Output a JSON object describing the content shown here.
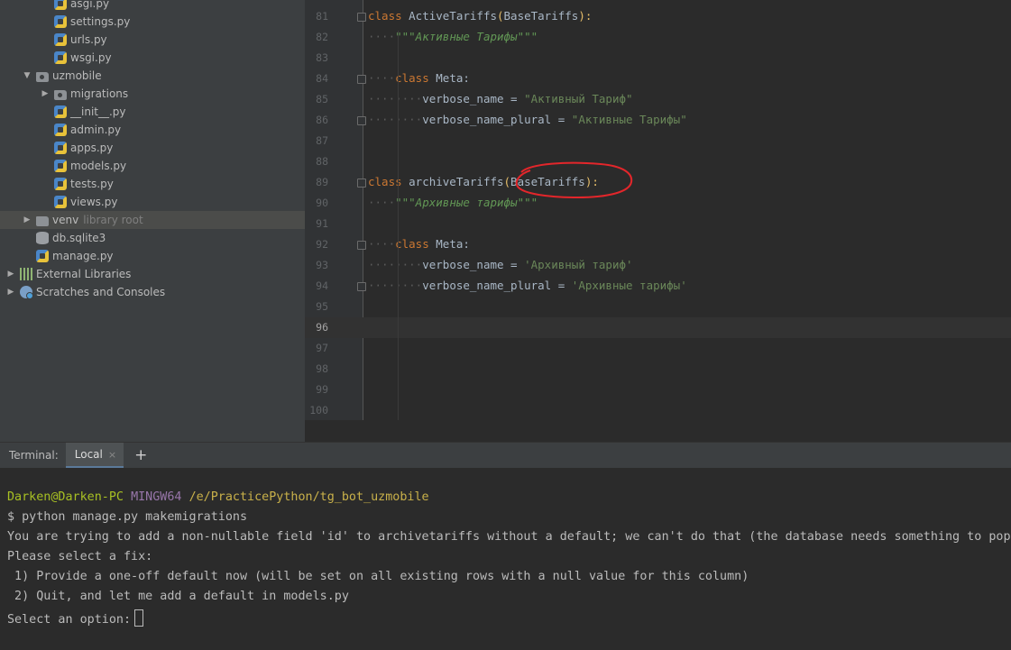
{
  "project_tree": {
    "items": [
      {
        "label": "asgi.py",
        "type": "py",
        "depth": 3,
        "arrow": ""
      },
      {
        "label": "settings.py",
        "type": "py",
        "depth": 3,
        "arrow": ""
      },
      {
        "label": "urls.py",
        "type": "py",
        "depth": 3,
        "arrow": ""
      },
      {
        "label": "wsgi.py",
        "type": "py",
        "depth": 3,
        "arrow": ""
      },
      {
        "label": "uzmobile",
        "type": "folder",
        "depth": 2,
        "arrow": "▼"
      },
      {
        "label": "migrations",
        "type": "folder",
        "depth": 3,
        "arrow": "▶"
      },
      {
        "label": "__init__.py",
        "type": "py",
        "depth": 3,
        "arrow": ""
      },
      {
        "label": "admin.py",
        "type": "py",
        "depth": 3,
        "arrow": ""
      },
      {
        "label": "apps.py",
        "type": "py",
        "depth": 3,
        "arrow": ""
      },
      {
        "label": "models.py",
        "type": "py",
        "depth": 3,
        "arrow": ""
      },
      {
        "label": "tests.py",
        "type": "py",
        "depth": 3,
        "arrow": ""
      },
      {
        "label": "views.py",
        "type": "py",
        "depth": 3,
        "arrow": ""
      },
      {
        "label": "venv",
        "type": "plainfolder",
        "depth": 2,
        "arrow": "▶",
        "suffix": "library root",
        "selected": true
      },
      {
        "label": "db.sqlite3",
        "type": "db",
        "depth": 2,
        "arrow": ""
      },
      {
        "label": "manage.py",
        "type": "py",
        "depth": 2,
        "arrow": ""
      },
      {
        "label": "External Libraries",
        "type": "lib",
        "depth": 0,
        "arrow": "▶"
      },
      {
        "label": "Scratches and Consoles",
        "type": "scratch",
        "depth": 0,
        "arrow": "▶"
      }
    ]
  },
  "editor": {
    "current_line": "96",
    "lines": [
      {
        "n": "81",
        "tokens": [
          {
            "t": "class ",
            "c": "kw"
          },
          {
            "t": "ActiveTariffs",
            "c": ""
          },
          {
            "t": "(",
            "c": "paren"
          },
          {
            "t": "BaseTariffs",
            "c": ""
          },
          {
            "t": "):",
            "c": "paren"
          }
        ]
      },
      {
        "n": "82",
        "tokens": [
          {
            "t": "····",
            "c": "ws"
          },
          {
            "t": "\"\"\"Активные Тарифы\"\"\"",
            "c": "doc"
          }
        ]
      },
      {
        "n": "83",
        "tokens": []
      },
      {
        "n": "84",
        "tokens": [
          {
            "t": "····",
            "c": "ws"
          },
          {
            "t": "class ",
            "c": "kw"
          },
          {
            "t": "Meta:",
            "c": ""
          }
        ]
      },
      {
        "n": "85",
        "tokens": [
          {
            "t": "········",
            "c": "ws"
          },
          {
            "t": "verbose_name = ",
            "c": ""
          },
          {
            "t": "\"Активный Тариф\"",
            "c": "str"
          }
        ]
      },
      {
        "n": "86",
        "tokens": [
          {
            "t": "········",
            "c": "ws"
          },
          {
            "t": "verbose_name_plural = ",
            "c": ""
          },
          {
            "t": "\"Активные Тарифы\"",
            "c": "str"
          }
        ]
      },
      {
        "n": "87",
        "tokens": []
      },
      {
        "n": "88",
        "tokens": []
      },
      {
        "n": "89",
        "tokens": [
          {
            "t": "class ",
            "c": "kw"
          },
          {
            "t": "archiveTariffs",
            "c": ""
          },
          {
            "t": "(",
            "c": "paren"
          },
          {
            "t": "BaseTariffs",
            "c": ""
          },
          {
            "t": "):",
            "c": "paren"
          }
        ]
      },
      {
        "n": "90",
        "tokens": [
          {
            "t": "····",
            "c": "ws"
          },
          {
            "t": "\"\"\"Архивные тарифы\"\"\"",
            "c": "doc"
          }
        ]
      },
      {
        "n": "91",
        "tokens": []
      },
      {
        "n": "92",
        "tokens": [
          {
            "t": "····",
            "c": "ws"
          },
          {
            "t": "class ",
            "c": "kw"
          },
          {
            "t": "Meta:",
            "c": ""
          }
        ]
      },
      {
        "n": "93",
        "tokens": [
          {
            "t": "········",
            "c": "ws"
          },
          {
            "t": "verbose_name = ",
            "c": ""
          },
          {
            "t": "'Архивный тариф'",
            "c": "str"
          }
        ]
      },
      {
        "n": "94",
        "tokens": [
          {
            "t": "········",
            "c": "ws"
          },
          {
            "t": "verbose_name_plural = ",
            "c": ""
          },
          {
            "t": "'Архивные тарифы'",
            "c": "str"
          }
        ]
      },
      {
        "n": "95",
        "tokens": []
      },
      {
        "n": "96",
        "tokens": []
      },
      {
        "n": "97",
        "tokens": []
      },
      {
        "n": "98",
        "tokens": []
      },
      {
        "n": "99",
        "tokens": []
      },
      {
        "n": "100",
        "tokens": []
      }
    ]
  },
  "terminal": {
    "label": "Terminal:",
    "tab_label": "Local",
    "tab_close": "×",
    "add_tab": "+",
    "prompt_user": "Darken@Darken-PC",
    "prompt_host": "MINGW64",
    "prompt_path": "/e/PracticePython/tg_bot_uzmobile",
    "lines": [
      "$ python manage.py makemigrations",
      "You are trying to add a non-nullable field 'id' to archivetariffs without a default; we can't do that (the database needs something to populate existing rows).",
      "Please select a fix:",
      " 1) Provide a one-off default now (will be set on all existing rows with a null value for this column)",
      " 2) Quit, and let me add a default in models.py"
    ],
    "input_prompt": "Select an option:"
  },
  "colors": {
    "keyword": "#cc7832",
    "string": "#6a8759",
    "annotation": "#e3262b"
  }
}
